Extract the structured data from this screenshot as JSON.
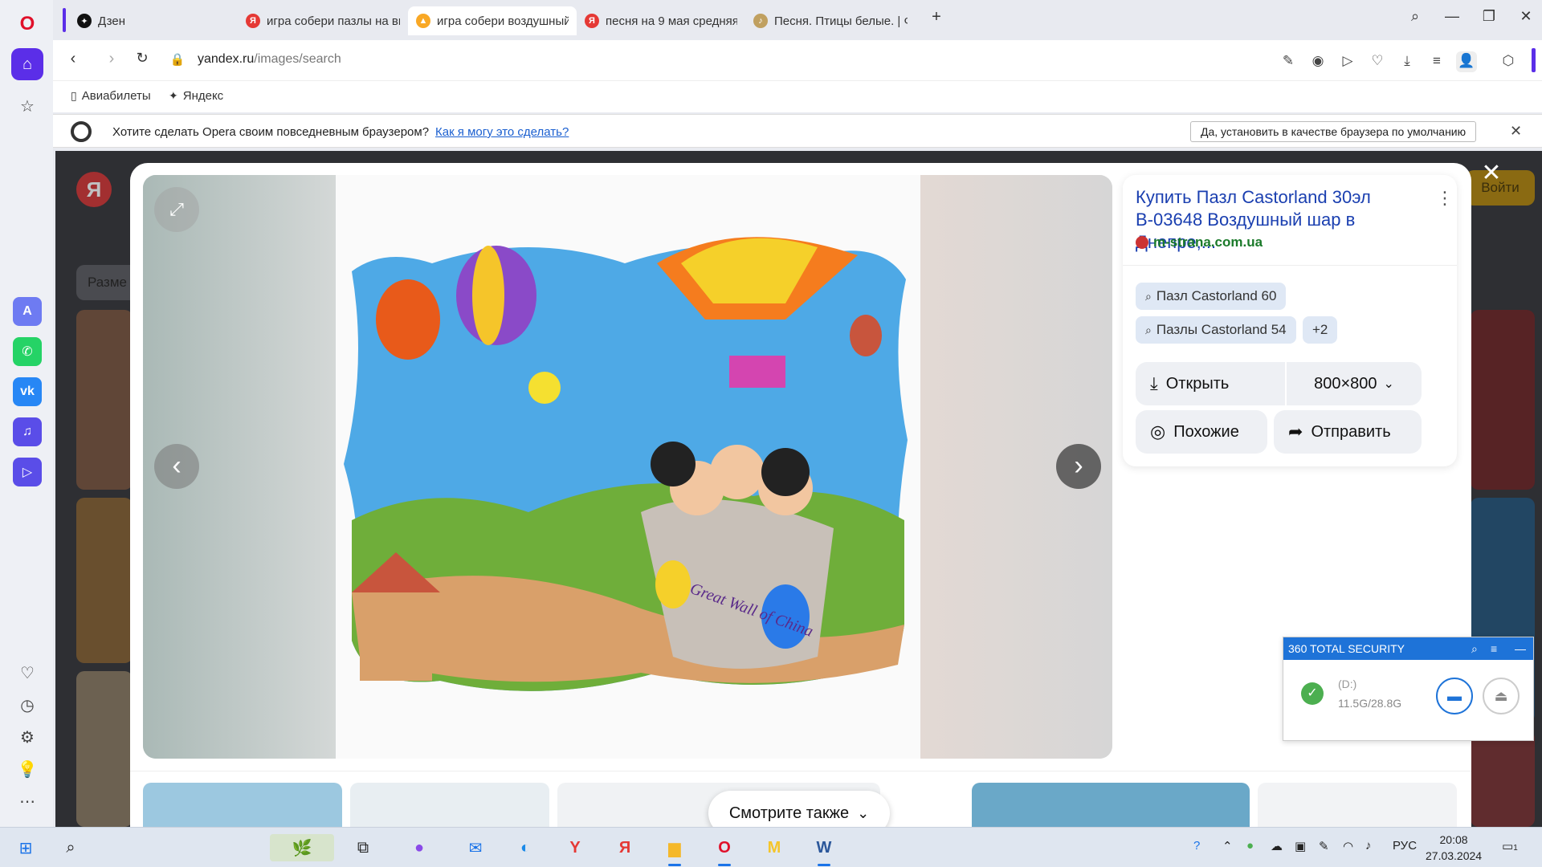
{
  "tabs": [
    {
      "label": "Дзен",
      "fav_color": "#111111",
      "fav_glyph": "✦"
    },
    {
      "label": "игра собери пазлы на вы",
      "fav_color": "#e53935",
      "fav_glyph": "Я"
    },
    {
      "label": "игра собери воздушный",
      "fav_color": "#f9a825",
      "fav_glyph": "▲"
    },
    {
      "label": "песня на 9 мая средняя г",
      "fav_color": "#e53935",
      "fav_glyph": "Я"
    },
    {
      "label": "Песня. Птицы белые. | Фо",
      "fav_color": "#c0a060",
      "fav_glyph": "♪"
    }
  ],
  "address": {
    "domain": "yandex.ru",
    "path": "/images/search"
  },
  "bookmarks": [
    {
      "label": "Авиабилеты",
      "icon": "page-icon"
    },
    {
      "label": "Яндекс",
      "icon": "yandex-star-icon"
    }
  ],
  "infobar": {
    "message": "Хотите сделать Opera своим повседневным браузером?",
    "link": "Как я могу это сделать?",
    "button": "Да, установить в качестве браузера по умолчанию"
  },
  "page": {
    "size_chip": "Разме",
    "login": "Войти"
  },
  "result": {
    "title": "Купить Пазл Castorland 30эл В-03648 Воздушный шар в Днепре,...",
    "site": "m-strana.com.ua",
    "chips": [
      "Пазл Castorland 60",
      "Пазлы Castorland 54",
      "+2"
    ],
    "open_label": "Открыть",
    "size_label": "800×800",
    "similar_label": "Похожие",
    "send_label": "Отправить"
  },
  "see_also": "Смотрите также",
  "widget": {
    "title": "360 TOTAL SECURITY",
    "drive": "(D:)",
    "space": "11.5G/28.8G"
  },
  "taskbar": {
    "lang": "РУС",
    "time": "20:08",
    "date": "27.03.2024",
    "notif_count": "1"
  },
  "image_caption": "Great Wall of China"
}
